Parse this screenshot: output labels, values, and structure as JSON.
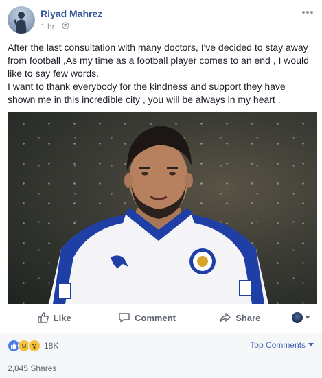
{
  "post": {
    "author": "Riyad Mahrez",
    "time": "1 hr",
    "separator": "·",
    "privacy_icon": "globe-icon",
    "more_icon": "ellipsis-icon",
    "paragraph_1": "After the last consultation with many doctors, I've decided to stay away from football ,As my time as a football player comes to an end , I would like to say few words.",
    "paragraph_2": "I want to thank everybody for the kindness and support they have shown me in this incredible city , you will be always in my heart ."
  },
  "actions": {
    "like_label": "Like",
    "comment_label": "Comment",
    "share_label": "Share"
  },
  "stats": {
    "reactions_count": "18K",
    "reaction_icons": [
      "like-icon",
      "sad-icon",
      "wow-icon"
    ],
    "top_comments_label": "Top Comments",
    "shares_label": "2,845 Shares"
  },
  "colors": {
    "author_link": "#365899",
    "link_blue": "#4267b2",
    "muted": "#90949c",
    "action_gray": "#606770",
    "stats_bg": "#f6f7f9",
    "like_blue": "#4a7de8",
    "reaction_yellow": "#f5c33b"
  }
}
